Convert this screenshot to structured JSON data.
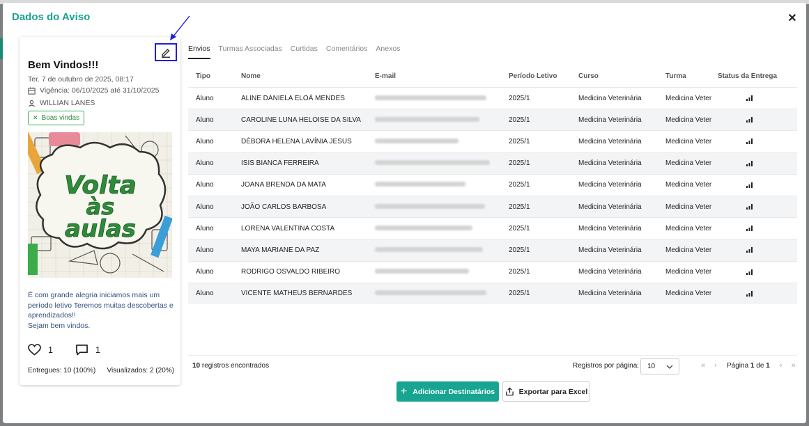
{
  "dialog": {
    "title": "Dados do Aviso",
    "close_icon": "close-icon"
  },
  "notice": {
    "title": "Bem Vindos!!!",
    "date": "Ter. 7 de outubro de 2025, 08:17",
    "validity": "Vigência: 06/10/2025 até 31/10/2025",
    "author": "WILLIAN LANES",
    "tag": "Boas vindas",
    "image_text": [
      "Volta",
      "às",
      "aulas"
    ],
    "body_lines": [
      "É com grande alegria iniciamos mais um período letivo Teremos muitas descobertas e aprendizados!!",
      "Sejam bem vindos."
    ],
    "likes": "1",
    "comments": "1",
    "delivered": "Entregues: 10 (100%)",
    "viewed": "Visualizados: 2 (20%)"
  },
  "tabs": [
    "Envios",
    "Turmas Associadas",
    "Curtidas",
    "Comentários",
    "Anexos"
  ],
  "table": {
    "headers": [
      "Tipo",
      "Nome",
      "E-mail",
      "Período Letivo",
      "Curso",
      "Turma",
      "Status da Entrega"
    ],
    "rows": [
      {
        "tipo": "Aluno",
        "nome": "ALINE DANIELA ELOÁ MENDES",
        "periodo": "2025/1",
        "curso": "Medicina Veterinária",
        "turma": "Medicina Veter"
      },
      {
        "tipo": "Aluno",
        "nome": "CAROLINE LUNA HELOISE DA SILVA",
        "periodo": "2025/1",
        "curso": "Medicina Veterinária",
        "turma": "Medicina Veter"
      },
      {
        "tipo": "Aluno",
        "nome": "DÉBORA HELENA LAVÍNIA JESUS",
        "periodo": "2025/1",
        "curso": "Medicina Veterinária",
        "turma": "Medicina Veter"
      },
      {
        "tipo": "Aluno",
        "nome": "ISIS BIANCA FERREIRA",
        "periodo": "2025/1",
        "curso": "Medicina Veterinária",
        "turma": "Medicina Veter"
      },
      {
        "tipo": "Aluno",
        "nome": "JOANA BRENDA DA MATA",
        "periodo": "2025/1",
        "curso": "Medicina Veterinária",
        "turma": "Medicina Veter"
      },
      {
        "tipo": "Aluno",
        "nome": "JOÃO CARLOS BARBOSA",
        "periodo": "2025/1",
        "curso": "Medicina Veterinária",
        "turma": "Medicina Veter"
      },
      {
        "tipo": "Aluno",
        "nome": "LORENA VALENTINA COSTA",
        "periodo": "2025/1",
        "curso": "Medicina Veterinária",
        "turma": "Medicina Veter"
      },
      {
        "tipo": "Aluno",
        "nome": "MAYA MARIANE DA PAZ",
        "periodo": "2025/1",
        "curso": "Medicina Veterinária",
        "turma": "Medicina Veter"
      },
      {
        "tipo": "Aluno",
        "nome": "RODRIGO OSVALDO RIBEIRO",
        "periodo": "2025/1",
        "curso": "Medicina Veterinária",
        "turma": "Medicina Veter"
      },
      {
        "tipo": "Aluno",
        "nome": "VICENTE MATHEUS BERNARDES",
        "periodo": "2025/1",
        "curso": "Medicina Veterinária",
        "turma": "Medicina Veter"
      }
    ]
  },
  "footer": {
    "records_count": "10",
    "records_label": " registros encontrados",
    "per_page_label": "Registros por página:",
    "per_page_value": "10",
    "page_label": "Página ",
    "page_current": "1",
    "page_of": " de ",
    "page_total": "1"
  },
  "actions": {
    "add_label": "Adicionar Destinatários",
    "export_label": "Exportar para Excel"
  },
  "colors": {
    "accent": "#17a591",
    "title": "#1aa391",
    "tag_border": "#2bb34a",
    "annotation": "#1f1fd8"
  }
}
